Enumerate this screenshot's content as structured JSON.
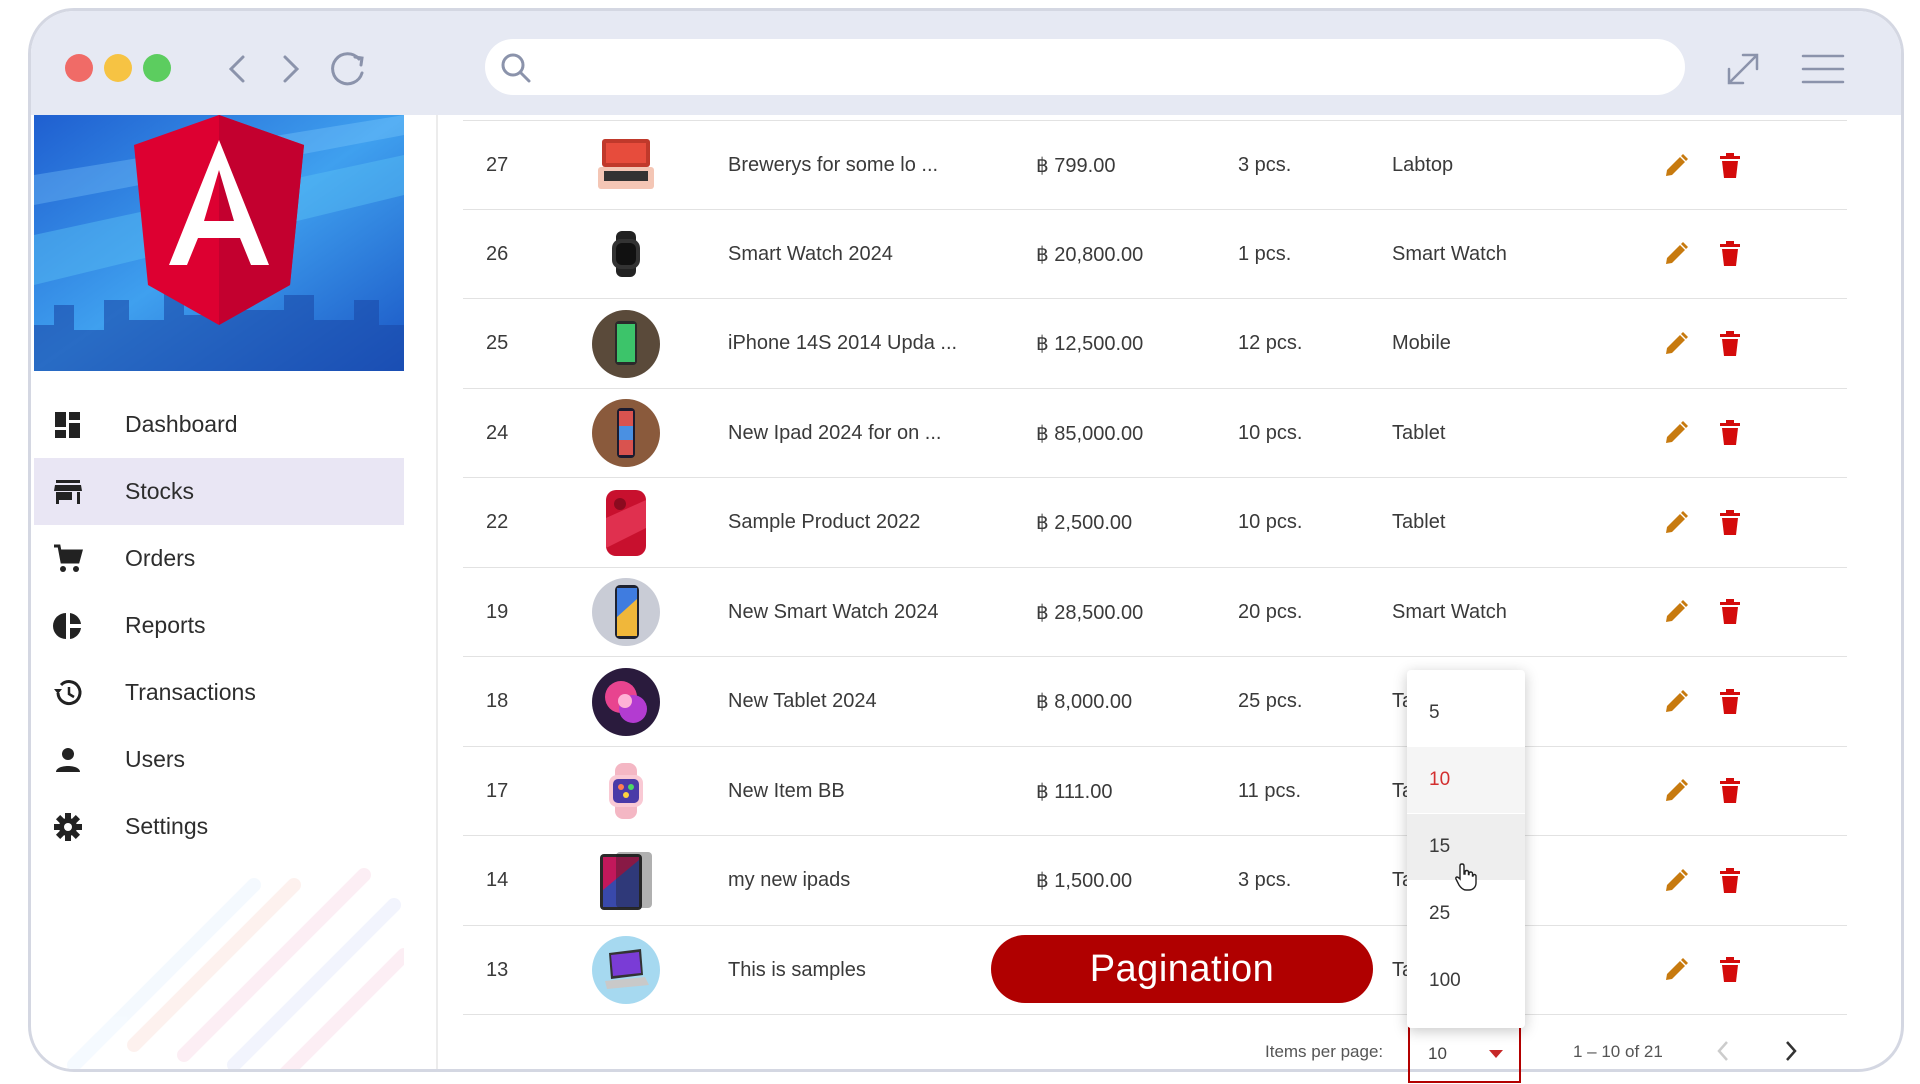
{
  "browser": {
    "search_placeholder": "",
    "icons": [
      "back-icon",
      "forward-icon",
      "reload-icon",
      "search-icon",
      "expand-icon",
      "hamburger-icon"
    ]
  },
  "sidebar": {
    "items": [
      {
        "label": "Dashboard",
        "icon": "dashboard-icon",
        "active": false
      },
      {
        "label": "Stocks",
        "icon": "store-icon",
        "active": true
      },
      {
        "label": "Orders",
        "icon": "cart-icon",
        "active": false
      },
      {
        "label": "Reports",
        "icon": "pie-chart-icon",
        "active": false
      },
      {
        "label": "Transactions",
        "icon": "history-icon",
        "active": false
      },
      {
        "label": "Users",
        "icon": "person-icon",
        "active": false
      },
      {
        "label": "Settings",
        "icon": "gear-icon",
        "active": false
      }
    ]
  },
  "table": {
    "rows": [
      {
        "id": "27",
        "name": "Brewerys for some lo ...",
        "price": "฿ 799.00",
        "stock": "3 pcs.",
        "category": "Labtop"
      },
      {
        "id": "26",
        "name": "Smart Watch 2024",
        "price": "฿ 20,800.00",
        "stock": "1 pcs.",
        "category": "Smart Watch"
      },
      {
        "id": "25",
        "name": "iPhone 14S 2014 Upda ...",
        "price": "฿ 12,500.00",
        "stock": "12 pcs.",
        "category": "Mobile"
      },
      {
        "id": "24",
        "name": "New Ipad 2024 for on ...",
        "price": "฿ 85,000.00",
        "stock": "10 pcs.",
        "category": "Tablet"
      },
      {
        "id": "22",
        "name": "Sample Product 2022",
        "price": "฿ 2,500.00",
        "stock": "10 pcs.",
        "category": "Tablet"
      },
      {
        "id": "19",
        "name": "New Smart Watch 2024",
        "price": "฿ 28,500.00",
        "stock": "20 pcs.",
        "category": "Smart Watch"
      },
      {
        "id": "18",
        "name": "New Tablet 2024",
        "price": "฿ 8,000.00",
        "stock": "25 pcs.",
        "category": "Ta"
      },
      {
        "id": "17",
        "name": "New Item BB",
        "price": "฿ 111.00",
        "stock": "11 pcs.",
        "category": "Ta"
      },
      {
        "id": "14",
        "name": "my new ipads",
        "price": "฿ 1,500.00",
        "stock": "3 pcs.",
        "category": "Ta"
      },
      {
        "id": "13",
        "name": "This is samples",
        "price": "",
        "stock": "",
        "category": "Ta"
      }
    ]
  },
  "pager": {
    "label": "Items per page:",
    "selected": "10",
    "range": "1 – 10 of 21",
    "options": [
      "5",
      "10",
      "15",
      "25",
      "100"
    ]
  },
  "badge": {
    "label": "Pagination"
  },
  "colors": {
    "accent": "#b00000",
    "edit": "#c77a0f",
    "delete": "#d40b0b",
    "active_bg": "#e9e6f4"
  }
}
